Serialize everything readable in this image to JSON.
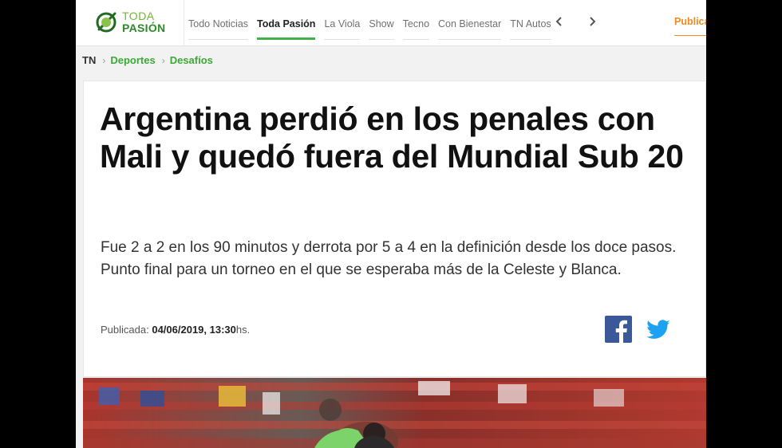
{
  "header": {
    "logo_line1": "TODA",
    "logo_line2": "PASIÓN",
    "nav": [
      {
        "label": "Todo Noticias",
        "active": false
      },
      {
        "label": "Toda Pasión",
        "active": true
      },
      {
        "label": "La Viola",
        "active": false
      },
      {
        "label": "Show",
        "active": false
      },
      {
        "label": "Tecno",
        "active": false
      },
      {
        "label": "Con Bienestar",
        "active": false
      },
      {
        "label": "TN Autos",
        "active": false
      }
    ],
    "publica_label": "Publica"
  },
  "breadcrumb": {
    "home": "TN",
    "items": [
      "Deportes",
      "Desafíos"
    ]
  },
  "article": {
    "headline": "Argentina perdió en los penales con Mali y quedó fuera del Mundial Sub 20",
    "summary": "Fue 2 a 2 en los 90 minutos y derrota por 5 a 4 en la definición desde los doce pasos. Punto final para un torneo en el que se esperaba más de la Celeste y Blanca.",
    "published_label": "Publicada:",
    "published_datetime": "04/06/2019, 13:30",
    "published_suffix": "hs."
  },
  "colors": {
    "brand_green": "#3fb04a",
    "publica_orange": "#f08a1d",
    "facebook": "#3b5998",
    "twitter": "#1da1f2"
  },
  "icons": [
    "chevron-left-icon",
    "chevron-right-icon",
    "facebook-icon",
    "twitter-icon"
  ]
}
